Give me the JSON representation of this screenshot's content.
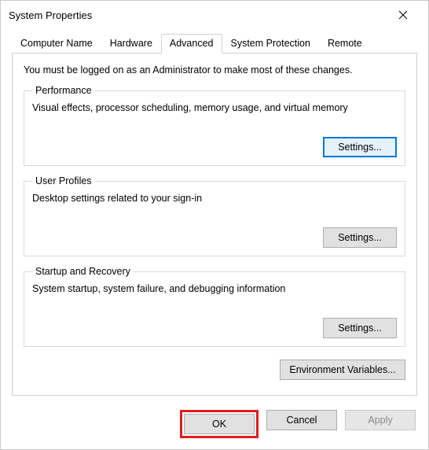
{
  "window": {
    "title": "System Properties"
  },
  "tabs": {
    "computer_name": "Computer Name",
    "hardware": "Hardware",
    "advanced": "Advanced",
    "system_protection": "System Protection",
    "remote": "Remote"
  },
  "intro": "You must be logged on as an Administrator to make most of these changes.",
  "performance": {
    "legend": "Performance",
    "desc": "Visual effects, processor scheduling, memory usage, and virtual memory",
    "button": "Settings..."
  },
  "user_profiles": {
    "legend": "User Profiles",
    "desc": "Desktop settings related to your sign-in",
    "button": "Settings..."
  },
  "startup_recovery": {
    "legend": "Startup and Recovery",
    "desc": "System startup, system failure, and debugging information",
    "button": "Settings..."
  },
  "env_button": "Environment Variables...",
  "dialog": {
    "ok": "OK",
    "cancel": "Cancel",
    "apply": "Apply"
  }
}
